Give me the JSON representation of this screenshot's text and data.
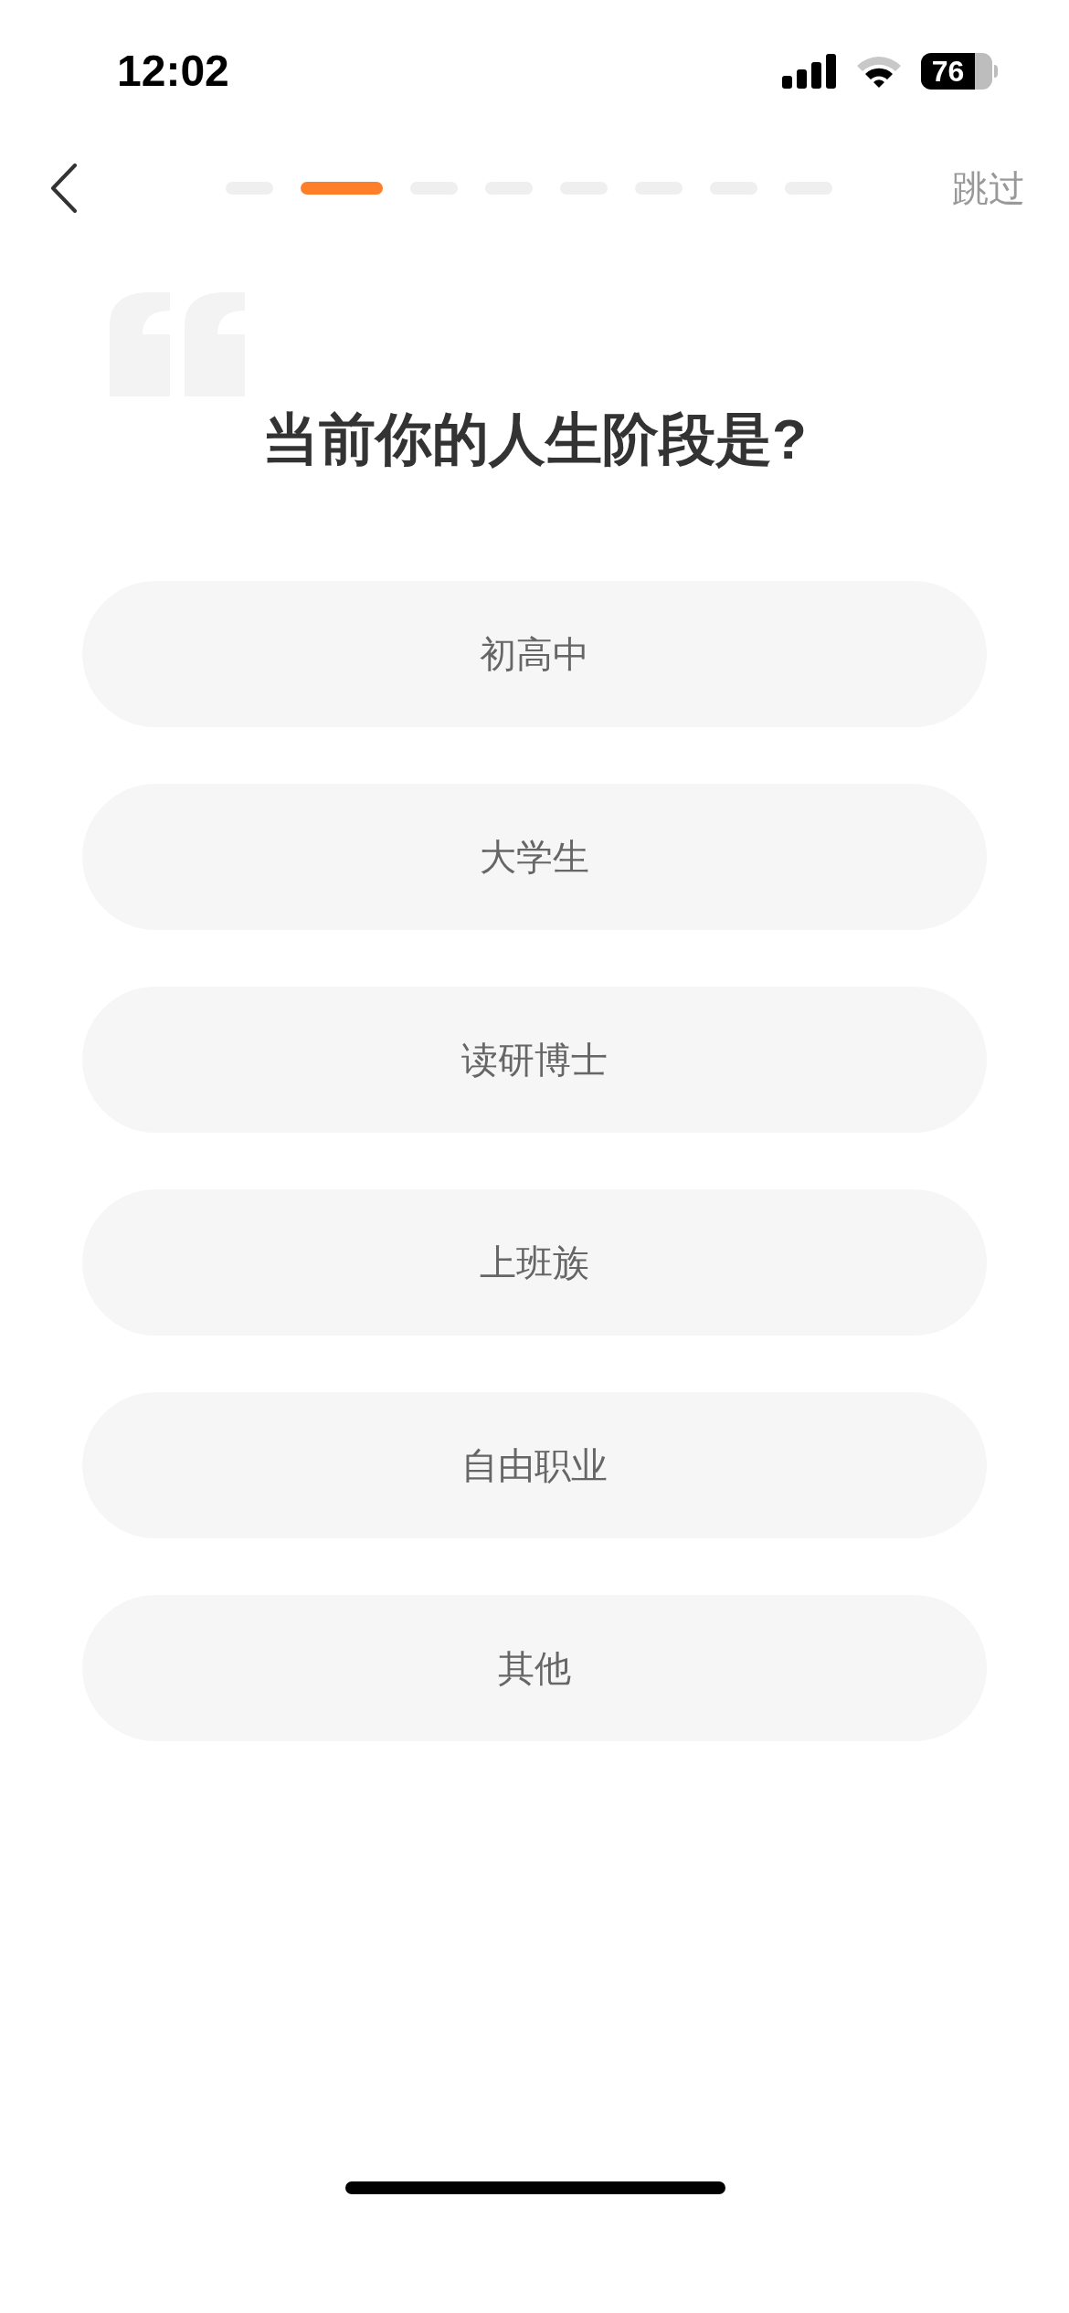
{
  "status_bar": {
    "time": "12:02",
    "battery": "76"
  },
  "nav": {
    "skip": "跳过"
  },
  "progress": [
    {
      "selected": false
    },
    {
      "selected": true
    },
    {
      "selected": false
    },
    {
      "selected": false
    },
    {
      "selected": false
    },
    {
      "selected": false
    },
    {
      "selected": false
    },
    {
      "selected": false
    }
  ],
  "question": "当前你的人生阶段是?",
  "options": [
    {
      "label": "初高中"
    },
    {
      "label": "大学生"
    },
    {
      "label": "读研博士"
    },
    {
      "label": "上班族"
    },
    {
      "label": "自由职业"
    },
    {
      "label": "其他"
    }
  ]
}
